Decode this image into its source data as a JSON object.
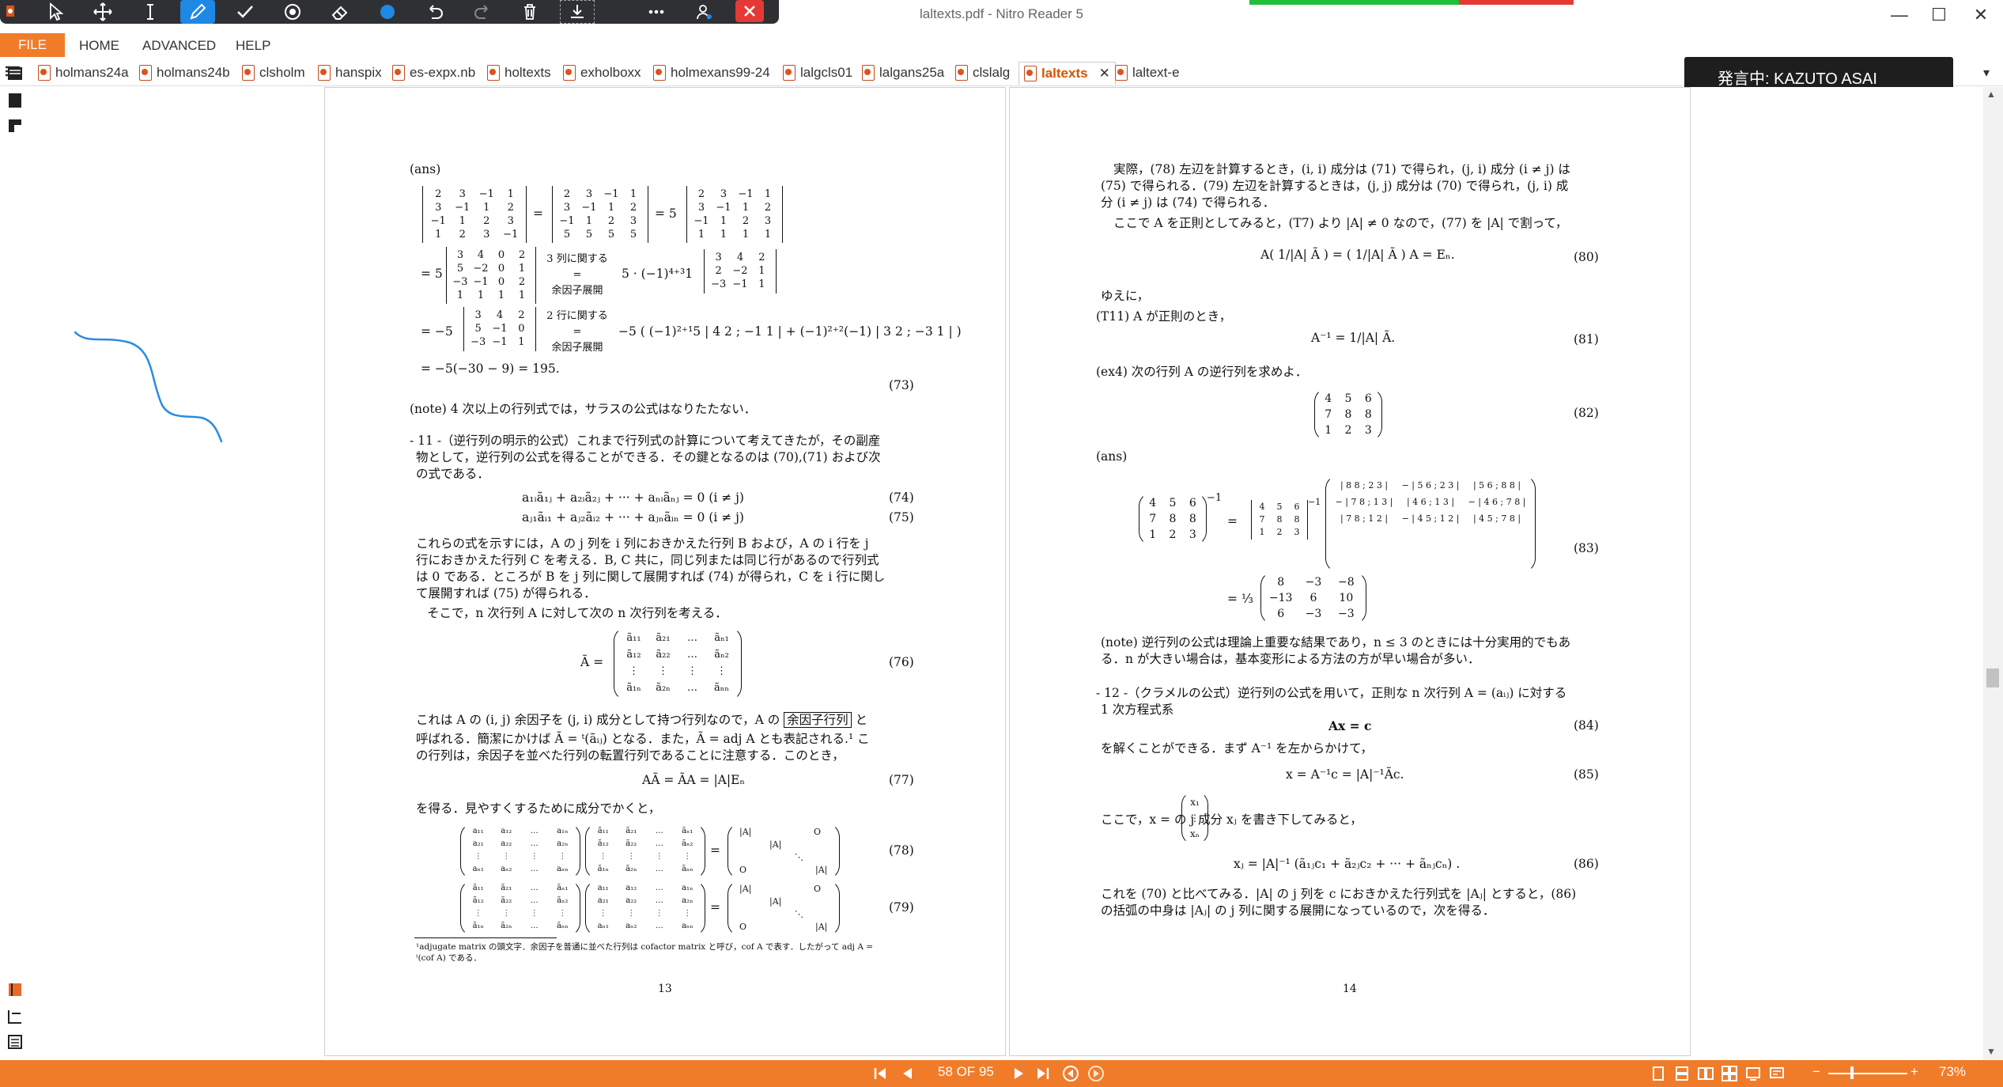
{
  "window": {
    "title": "laltexts.pdf - Nitro Reader 5",
    "minimize": "—",
    "maximize": "☐",
    "close": "✕"
  },
  "ribbon": {
    "file": "FILE",
    "home": "HOME",
    "advanced": "ADVANCED",
    "help": "HELP"
  },
  "tabs": [
    {
      "label": "holmans24a"
    },
    {
      "label": "holmans24b"
    },
    {
      "label": "clsholm"
    },
    {
      "label": "hanspix"
    },
    {
      "label": "es-expx.nb"
    },
    {
      "label": "holtexts"
    },
    {
      "label": "exholboxx"
    },
    {
      "label": "holmexans99-24"
    },
    {
      "label": "lalgcls01"
    },
    {
      "label": "lalgans25a"
    },
    {
      "label": "clslalg"
    },
    {
      "label": "laltexts"
    },
    {
      "label": "laltext-e"
    }
  ],
  "tab_close": "✕",
  "speaking": "発言中: KAZUTO ASAI",
  "page_left": {
    "ans": "(ans)",
    "eq73_end": "= −5(−30 − 9) = 195.",
    "eq73": "(73)",
    "note1": "(note) 4 次以上の行列式では，サラスの公式はなりたたない．",
    "sec11_line1": "- 11 -（逆行列の明示的公式）これまで行列式の計算について考えてきたが，その副産",
    "sec11_line2": "物として，逆行列の公式を得ることができる．その鍵となるのは (70),(71) および次",
    "sec11_line3": "の式である．",
    "eq74_text": "a₁ᵢã₁ⱼ + a₂ᵢã₂ⱼ + ··· + aₙᵢãₙⱼ = 0        (i ≠ j)",
    "eq74": "(74)",
    "eq75_text": "aⱼ₁ãᵢ₁ + aⱼ₂ãᵢ₂ + ··· + aⱼₙãᵢₙ = 0        (i ≠ j)",
    "eq75": "(75)",
    "para1_l1": "これらの式を示すには，A の j 列を i 列におきかえた行列 B および，A の i 行を j",
    "para1_l2": "行におきかえた行列 C を考える．B, C 共に，同じ列または同じ行があるので行列式",
    "para1_l3": "は 0 である．ところが B を j 列に関して展開すれば (74) が得られ，C を i 行に関し",
    "para1_l4": "て展開すれば (75) が得られる．",
    "para2": "そこで，n 次行列 A に対して次の n 次行列を考える．",
    "eq76": "(76)",
    "para3_l1": "これは A の (i, j) 余因子を (j, i) 成分として持つ行列なので，A の",
    "para3_box": "余因子行列",
    "para3_l1b": "と",
    "para3_l2": "呼ばれる．簡潔にかけば Ã = ᵗ(ãᵢⱼ) となる．また，Ã = adj A とも表記される.¹ こ",
    "para3_l3": "の行列は，余因子を並べた行列の転置行列であることに注意する．このとき，",
    "eq77_text": "AÃ = ÃA = |A|Eₙ",
    "eq77": "(77)",
    "para4": "を得る．見やすくするために成分でかくと，",
    "eq78": "(78)",
    "eq79": "(79)",
    "footnote_l1": "¹adjugate matrix の頭文字．余因子を普通に並べた行列は cofactor matrix と呼び，cof A で表す．したがって adj A =",
    "footnote_l2": "ᵗ(cof A) である．",
    "page_number": "13",
    "mat_note1": "3 列に関する",
    "mat_note2": "余因子展開",
    "mat_note3": "2 行に関する",
    "mat_note4": "余因子展開"
  },
  "page_right": {
    "p1_l1": "実際，(78) 左辺を計算するとき，(i, i) 成分は (71) で得られ，(j, i) 成分 (i ≠ j) は",
    "p1_l2": "(75) で得られる．(79) 左辺を計算するときは，(j, j) 成分は (70) で得られ，(j, i) 成",
    "p1_l3": "分 (i ≠ j) は (74) で得られる．",
    "p2": "ここで A を正則としてみると，(T7) より |A| ≠ 0 なので，(77) を |A| で割って，",
    "eq80_text": "A( 1/|A| Ã ) = ( 1/|A| Ã ) A = Eₙ.",
    "eq80": "(80)",
    "p3": "ゆえに，",
    "p4": "(T11) A が正則のとき，",
    "eq81_text": "A⁻¹ = 1/|A| Ã.",
    "eq81": "(81)",
    "p5": "(ex4) 次の行列 A の逆行列を求めよ．",
    "eq82": "(82)",
    "ans": "(ans)",
    "eq83": "(83)",
    "note_l1": "(note) 逆行列の公式は理論上重要な結果であり，n ≤ 3 のときには十分実用的でもあ",
    "note_l2": "る．n が大きい場合は，基本変形による方法の方が早い場合が多い．",
    "sec12_l1": "- 12 -（クラメルの公式）逆行列の公式を用いて，正則な n 次行列 A = (aᵢⱼ) に対する",
    "sec12_l2": "1 次方程式系",
    "eq84_text": "Ax = c",
    "eq84": "(84)",
    "p6": "を解くことができる．まず A⁻¹ を左からかけて，",
    "eq85_text": "x = A⁻¹c = |A|⁻¹Ãc.",
    "eq85": "(85)",
    "p7": "ここで，x =        の j 成分 xⱼ を書き下してみると，",
    "eq86_text": "xⱼ = |A|⁻¹ (ã₁ⱼc₁ + ã₂ⱼc₂ + ··· + ãₙⱼcₙ) .",
    "eq86": "(86)",
    "p8_l1": "これを (70) と比べてみる．|A| の j 列を c におきかえた行列式を |Aⱼ| とすると，(86)",
    "p8_l2": "の括弧の中身は |Aⱼ| の j 列に関する展開になっているので，次を得る．",
    "page_number": "14"
  },
  "statusbar": {
    "page_indicator": "58 OF 95",
    "zoom": "73%",
    "zoom_minus": "−",
    "zoom_plus": "+"
  },
  "colors": {
    "accent": "#f07c2a",
    "toolbar_bg": "#2f3033",
    "active_tool": "#1e88e5",
    "ink_stroke": "#2b8be0",
    "close_red": "#e53935"
  }
}
